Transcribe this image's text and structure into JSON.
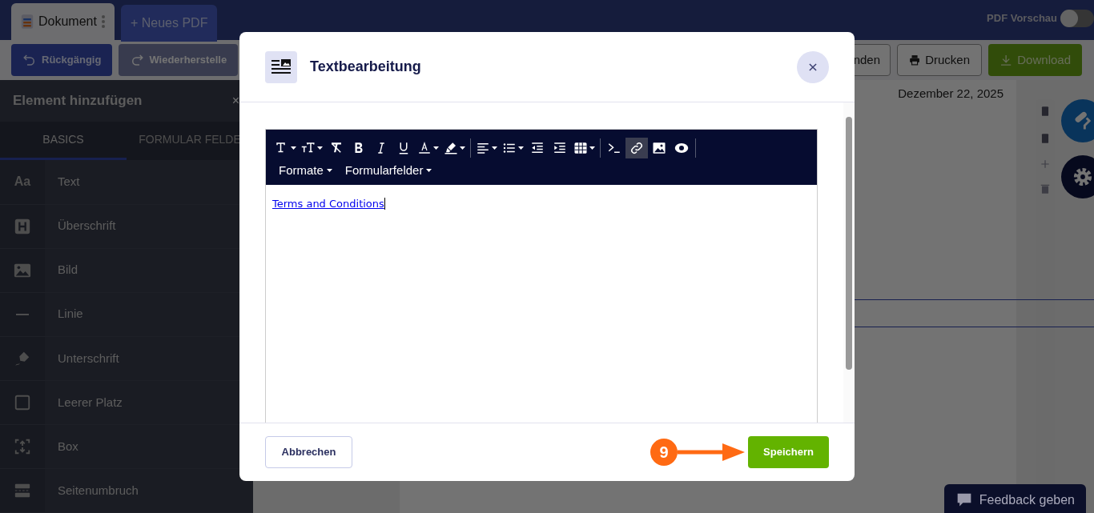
{
  "app_tabs": [
    {
      "label": "Dokument",
      "selected": true
    },
    {
      "label": "+ Neues PDF",
      "selected": false
    }
  ],
  "pdf_preview": {
    "label": "PDF Vorschau",
    "on": false
  },
  "toolbar": [
    {
      "kind": "undo",
      "label": "Rückgängig",
      "disabled": false
    },
    {
      "kind": "redo",
      "label": "Wiederherstelle",
      "disabled": true
    },
    {
      "kind": "plain",
      "label": "nden",
      "disabled": false
    },
    {
      "kind": "print",
      "label": "Drucken",
      "disabled": false
    },
    {
      "kind": "download",
      "label": "Download",
      "disabled": false
    }
  ],
  "sidebar": {
    "title": "Element hinzufügen",
    "close": "×",
    "tabs": [
      {
        "label": "BASICS",
        "selected": true
      },
      {
        "label": "FORMULAR FELDE",
        "selected": false
      }
    ],
    "items": [
      {
        "kind": "text",
        "label": "Text",
        "icon_text": "Aa"
      },
      {
        "kind": "heading",
        "label": "Überschrift"
      },
      {
        "kind": "image",
        "label": "Bild"
      },
      {
        "kind": "line",
        "label": "Linie"
      },
      {
        "kind": "signature",
        "label": "Unterschrift"
      },
      {
        "kind": "blank",
        "label": "Leerer Platz"
      },
      {
        "kind": "box",
        "label": "Box"
      },
      {
        "kind": "pagebreak",
        "label": "Seitenumbruch"
      }
    ]
  },
  "document": {
    "date": "Dezember 22, 2025"
  },
  "modal": {
    "title": "Textbearbeitung",
    "editor_tools": [
      {
        "kind": "font",
        "dropdown": true,
        "selected": false
      },
      {
        "kind": "size",
        "dropdown": true,
        "selected": false
      },
      {
        "kind": "clear",
        "dropdown": false,
        "selected": false
      },
      {
        "kind": "bold",
        "dropdown": false,
        "selected": false
      },
      {
        "kind": "italic",
        "dropdown": false,
        "selected": false
      },
      {
        "kind": "underline",
        "dropdown": false,
        "selected": false
      },
      {
        "kind": "color",
        "dropdown": true,
        "selected": false
      },
      {
        "kind": "highlight",
        "dropdown": true,
        "selected": false
      },
      {
        "kind": "separator"
      },
      {
        "kind": "align",
        "dropdown": true,
        "selected": false
      },
      {
        "kind": "list",
        "dropdown": true,
        "selected": false
      },
      {
        "kind": "outdent",
        "dropdown": false,
        "selected": false
      },
      {
        "kind": "indent",
        "dropdown": false,
        "selected": false
      },
      {
        "kind": "table",
        "dropdown": true,
        "selected": false
      },
      {
        "kind": "separator"
      },
      {
        "kind": "code",
        "dropdown": false,
        "selected": false
      },
      {
        "kind": "link",
        "dropdown": false,
        "selected": true
      },
      {
        "kind": "image",
        "dropdown": false,
        "selected": false
      },
      {
        "kind": "preview",
        "dropdown": false,
        "selected": false
      },
      {
        "kind": "separator"
      }
    ],
    "editor_menus": [
      "Formate",
      "Formularfelder"
    ],
    "content_link": "Terms and Conditions",
    "cancel": "Abbrechen",
    "save": "Speichern",
    "step": "9"
  },
  "feedback": "Feedback geben"
}
